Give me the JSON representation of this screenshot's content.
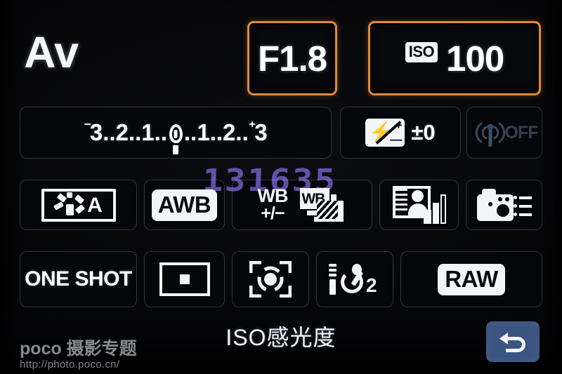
{
  "screen": {
    "device": "camera-quick-control-screen",
    "background_color": "#000000",
    "accent_highlight_color": "#e08a3c",
    "cell_border_color": "#96a5cd",
    "return_button_color": "#3c5480"
  },
  "row1": {
    "shooting_mode": "Av",
    "aperture": {
      "value": "F1.8",
      "highlighted": true
    },
    "iso": {
      "badge": "ISO",
      "value": "100",
      "highlighted": true
    }
  },
  "row2": {
    "exposure_compensation": {
      "minus_sign": "⁻",
      "left_labels": [
        "3",
        "2",
        "1"
      ],
      "center_label": "0",
      "right_labels": [
        "1",
        "2"
      ],
      "plus_sign": "⁺",
      "right_end_label": "3",
      "dots": "..",
      "marker_position": "0"
    },
    "flash_compensation": {
      "icon": "flash-exposure-compensation-icon",
      "value": "±0"
    },
    "wireless": {
      "icon": "wireless-antenna-icon",
      "status": "OFF",
      "enabled": false
    }
  },
  "row3": {
    "picture_style": {
      "icon": "picture-style-icon",
      "value": "A"
    },
    "white_balance": {
      "value": "AWB"
    },
    "wb_correction": {
      "top": "WB",
      "bottom": "+/−"
    },
    "wb_bracketing": {
      "icon": "wb-bracketing-icon",
      "label": "WB"
    },
    "auto_lighting_optimizer": {
      "icon": "auto-lighting-optimizer-icon"
    },
    "custom_functions": {
      "icon": "camera-settings-list-icon"
    }
  },
  "row4": {
    "af_mode": {
      "value": "ONE SHOT"
    },
    "af_point": {
      "icon": "af-point-selection-icon"
    },
    "metering_mode": {
      "icon": "evaluative-metering-icon"
    },
    "drive_mode": {
      "icon": "self-timer-icon",
      "value": "2"
    },
    "image_quality": {
      "value": "RAW"
    }
  },
  "bottom": {
    "title": "ISO感光度",
    "return_button": {
      "icon": "return-arrow-icon",
      "label": "Return"
    }
  },
  "watermark": {
    "brand": "poco",
    "subtitle": "摄影专题",
    "url": "http://photo.poco.cn/"
  },
  "artifacts": {
    "ghost_digits": "131635"
  }
}
